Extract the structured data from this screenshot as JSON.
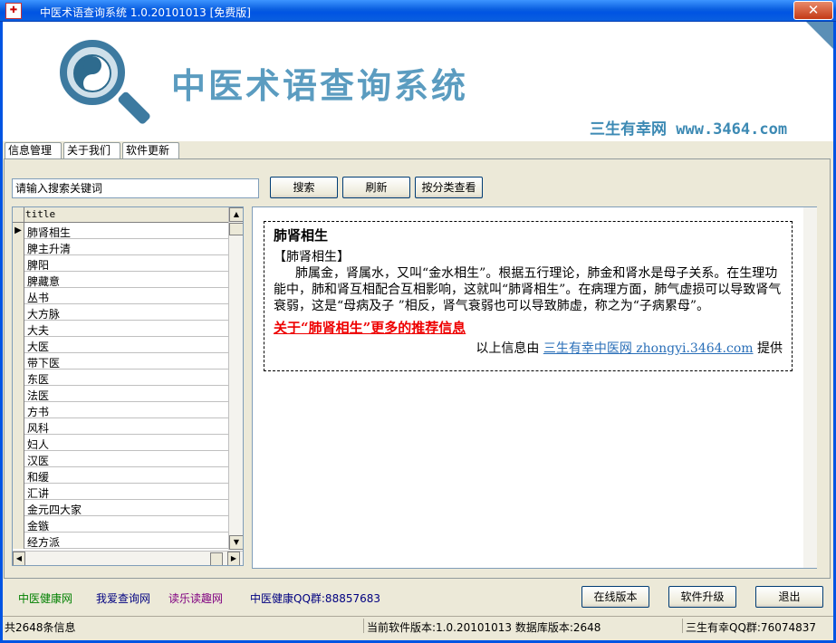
{
  "window": {
    "title": "中医术语查询系统 1.0.20101013 [免费版]",
    "close_glyph": "✕"
  },
  "header": {
    "brand": "中医术语查询系统",
    "site": "三生有幸网 www.3464.com"
  },
  "tabs": [
    "信息管理",
    "关于我们",
    "软件更新"
  ],
  "toolbar": {
    "search_value": "请输入搜索关键词",
    "search_btn": "搜索",
    "refresh_btn": "刷新",
    "category_btn": "按分类查看"
  },
  "grid": {
    "column": "title",
    "selected_marker": "▶",
    "rows": [
      "肺肾相生",
      "脾主升清",
      "脾阳",
      "脾藏意",
      "丛书",
      "大方脉",
      "大夫",
      "大医",
      "带下医",
      "东医",
      "法医",
      "方书",
      "风科",
      "妇人",
      "汉医",
      "和缓",
      "汇讲",
      "金元四大家",
      "金镞",
      "经方派"
    ]
  },
  "detail": {
    "title": "肺肾相生",
    "subtitle": "【肺肾相生】",
    "body": "肺属金，肾属水，又叫“金水相生”。根据五行理论，肺金和肾水是母子关系。在生理功能中，肺和肾互相配合互相影响，这就叫“肺肾相生”。在病理方面，肺气虚损可以导致肾气衰弱，这是“母病及子 ”相反，肾气衰弱也可以导致肺虚，称之为“子病累母”。",
    "more_link": "关于“肺肾相生”更多的推荐信息",
    "source_prefix": "以上信息由",
    "source_link": "三生有幸中医网 zhongyi.3464.com",
    "source_suffix": "提供"
  },
  "footer": {
    "links": [
      "中医健康网",
      "我爱查询网",
      "读乐读趣网"
    ],
    "qq_group": "中医健康QQ群:88857683",
    "online_btn": "在线版本",
    "upgrade_btn": "软件升级",
    "exit_btn": "退出"
  },
  "status": {
    "count": "共2648条信息",
    "version": "当前软件版本:1.0.20101013 数据库版本:2648",
    "qq": "三生有幸QQ群:76074837"
  },
  "colors": {
    "link_green": "#008000",
    "link_navy": "#000080",
    "link_purple": "#800080",
    "more_red": "#e00000",
    "brand_blue": "#5b9cc0"
  }
}
